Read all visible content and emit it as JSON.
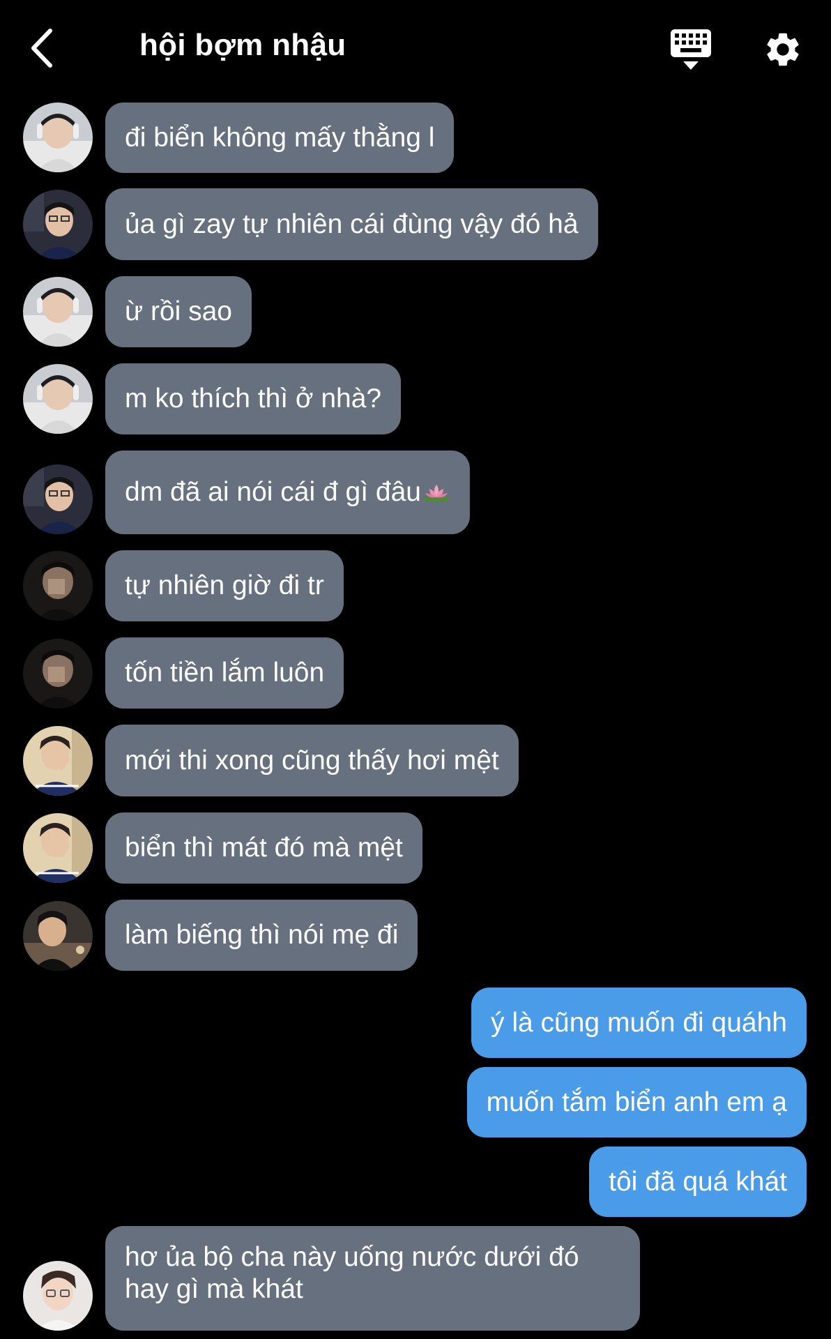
{
  "header": {
    "title": "hội bợm nhậu",
    "back_icon": "chevron-left-icon",
    "keyboard_icon": "keyboard-hide-icon",
    "settings_icon": "gear-icon"
  },
  "colors": {
    "background": "#000000",
    "incoming_bubble": "#66707e",
    "outgoing_bubble": "#4a9be8"
  },
  "messages": [
    {
      "direction": "in",
      "text": "đi biển không mấy thằng l"
    },
    {
      "direction": "in",
      "text": "ủa gì zay tự nhiên cái đùng vậy đó hả"
    },
    {
      "direction": "in",
      "text": "ừ rồi sao"
    },
    {
      "direction": "in",
      "text": "m ko thích thì ở nhà?"
    },
    {
      "direction": "in",
      "text": "dm đã ai nói cái đ gì đâu",
      "emoji": "lotus-emoji"
    },
    {
      "direction": "in",
      "text": "tự nhiên giờ đi tr"
    },
    {
      "direction": "in",
      "text": "tốn tiền lắm luôn"
    },
    {
      "direction": "in",
      "text": "mới thi xong cũng thấy hơi mệt"
    },
    {
      "direction": "in",
      "text": "biển thì mát đó mà mệt"
    },
    {
      "direction": "in",
      "text": "làm biếng thì nói mẹ đi"
    },
    {
      "direction": "out",
      "text": "ý là cũng muốn đi quáhh"
    },
    {
      "direction": "out",
      "text": "muốn tắm biển anh em ạ"
    },
    {
      "direction": "out",
      "text": "tôi đã quá khát"
    },
    {
      "direction": "in",
      "text": "hơ ủa bộ cha này uống nước dưới đó hay gì mà khát"
    }
  ]
}
